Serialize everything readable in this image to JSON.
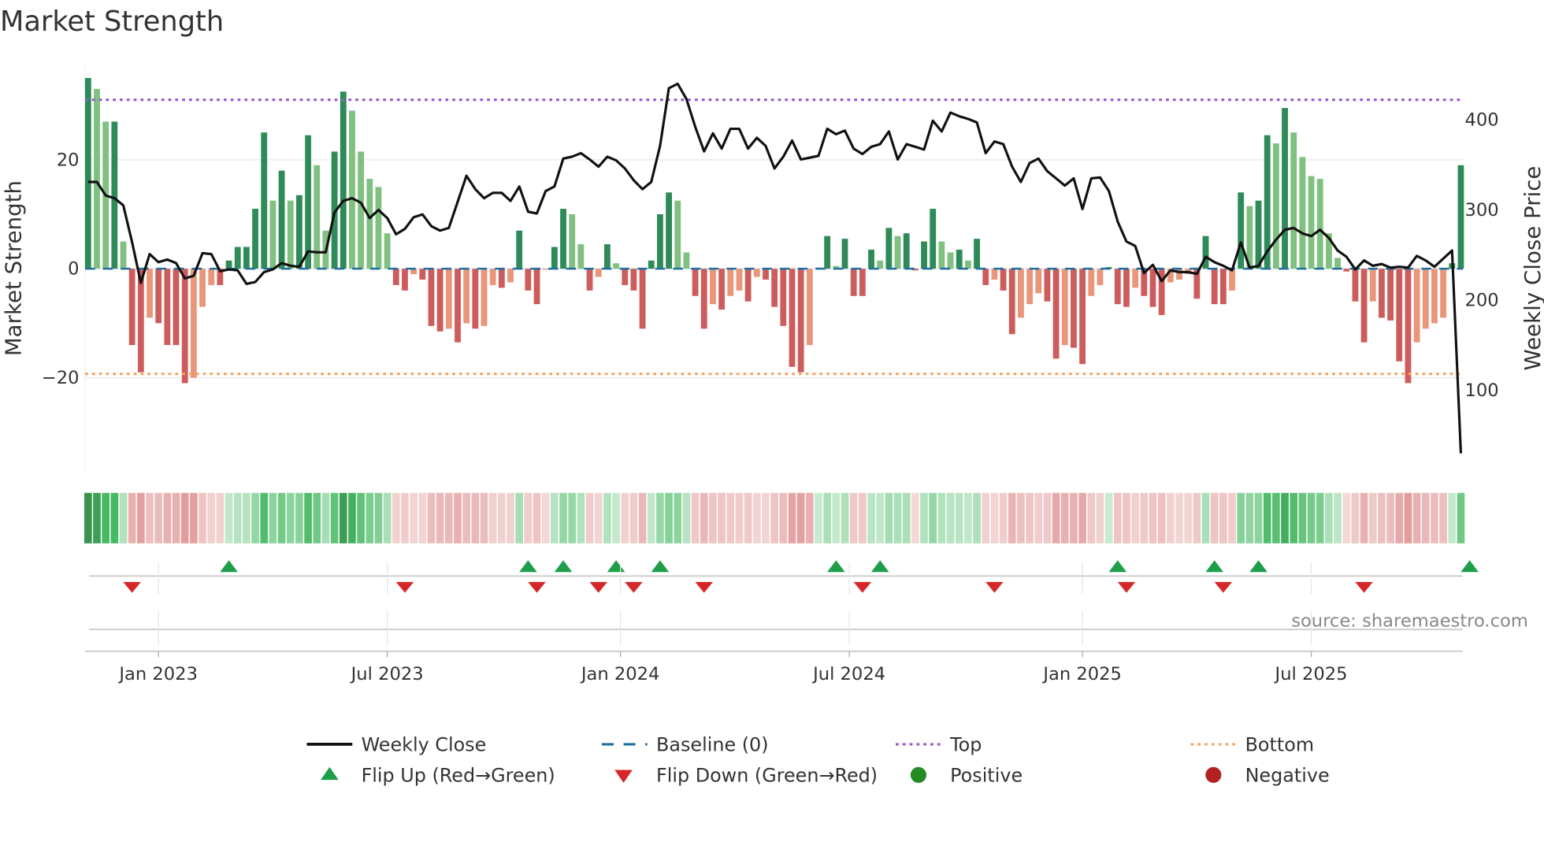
{
  "chart_data": {
    "type": "bar",
    "title": "Market Strength",
    "ylabel": "Market Strength",
    "y2label": "Weekly Close Price",
    "ylim": [
      -37.5,
      37.5
    ],
    "y2lim": [
      8,
      461.5
    ],
    "yticks": [
      -20,
      0,
      20
    ],
    "yticks_labels": [
      "−20",
      "0",
      "20"
    ],
    "y2ticks": [
      100,
      200,
      300,
      400
    ],
    "y2ticks_labels": [
      "100",
      "200",
      "300",
      "400"
    ],
    "xticks": [
      {
        "label": "Jan 2023",
        "index": 8
      },
      {
        "label": "Jul 2023",
        "index": 34
      },
      {
        "label": "Jan 2024",
        "index": 60.5
      },
      {
        "label": "Jul 2024",
        "index": 86.5
      },
      {
        "label": "Jan 2025",
        "index": 113
      },
      {
        "label": "Jul 2025",
        "index": 139
      }
    ],
    "top_level": 31,
    "bottom_level": -19.3,
    "baseline": 0,
    "grid": true,
    "strength": [
      35,
      33,
      27,
      27,
      5,
      -14,
      -19,
      -9,
      -10,
      -14,
      -14,
      -21,
      -20,
      -7,
      -3,
      -3,
      1.5,
      4,
      4,
      11,
      25,
      12.5,
      18,
      12.5,
      13.5,
      24.5,
      19,
      7,
      21.5,
      32.5,
      29,
      21.5,
      16.5,
      15,
      6.5,
      -3,
      -4,
      -1,
      -2,
      -10.5,
      -11.5,
      -11,
      -13.5,
      -10,
      -11,
      -10.5,
      -3,
      -3.5,
      -2.5,
      7,
      -4,
      -6.5,
      -0.2,
      4,
      11,
      10,
      4.5,
      -4,
      -1.5,
      4.5,
      1,
      -3,
      -4,
      -11,
      1.5,
      10,
      14,
      12.5,
      3,
      -5,
      -11,
      -6.5,
      -7.5,
      -5,
      -4,
      -6,
      -1.5,
      -2,
      -7,
      -10.5,
      -18,
      -19,
      -14,
      0.2,
      6,
      0.5,
      5.5,
      -5,
      -5,
      3.5,
      1.5,
      7.5,
      6,
      6.5,
      -0.3,
      5,
      11,
      5,
      3,
      3.5,
      1.5,
      5.5,
      -3,
      -2,
      -4,
      -12,
      -9,
      -6.5,
      -4.5,
      -6,
      -16.5,
      -14,
      -14.5,
      -17.5,
      -5,
      -3,
      0.3,
      -6.5,
      -7,
      -3.5,
      -5,
      -7,
      -8.5,
      -2.5,
      -2,
      -1,
      -5.5,
      6,
      -6.5,
      -6.5,
      -4,
      14,
      11.5,
      12.5,
      24.5,
      23,
      29.5,
      25,
      20.5,
      17,
      16.5,
      6.5,
      2,
      -0.5,
      -6,
      -13.5,
      -6,
      -9,
      -9.5,
      -17,
      -21,
      -13.5,
      -11,
      -10,
      -9,
      1,
      19
    ],
    "weekly_close": [
      331,
      331,
      316,
      313,
      305,
      264,
      219,
      251,
      242,
      245,
      241,
      224,
      227,
      252,
      251,
      232,
      234,
      233,
      218,
      220,
      231,
      234,
      241,
      238,
      237,
      254,
      253,
      253,
      297,
      310,
      313,
      308,
      291,
      300,
      291,
      273,
      279,
      292,
      295,
      282,
      277,
      280,
      309,
      338,
      323,
      313,
      319,
      319,
      310,
      326,
      298,
      296,
      321,
      326,
      357,
      359,
      363,
      356,
      348,
      359,
      355,
      346,
      333,
      323,
      331,
      371,
      435,
      440,
      423,
      392,
      365,
      385,
      368,
      390,
      390,
      368,
      380,
      371,
      346,
      359,
      377,
      356,
      358,
      360,
      390,
      384,
      388,
      368,
      362,
      370,
      373,
      387,
      356,
      373,
      370,
      367,
      399,
      387,
      408,
      404,
      401,
      397,
      363,
      376,
      373,
      348,
      331,
      352,
      357,
      343,
      335,
      327,
      335,
      301,
      335,
      336,
      321,
      287,
      265,
      260,
      230,
      239,
      221,
      233,
      231,
      231,
      229,
      248,
      242,
      238,
      233,
      264,
      236,
      238,
      254,
      267,
      278,
      280,
      274,
      271,
      278,
      269,
      255,
      248,
      234,
      244,
      238,
      240,
      236,
      237,
      236,
      249,
      244,
      237,
      246,
      255,
      30
    ],
    "flip_up_indices": [
      16,
      50,
      54,
      60,
      65,
      85,
      90,
      117,
      128,
      133,
      157
    ],
    "flip_down_indices": [
      5,
      36,
      51,
      58,
      62,
      70,
      88,
      103,
      118,
      129,
      145
    ],
    "colors": {
      "positive_strong": "#2e8b57",
      "positive_weak": "#80c080",
      "negative_strong": "#cd5c5c",
      "negative_weak": "#e9967a",
      "top": "#9b59d0",
      "bottom": "#f4a460",
      "baseline": "#1f6f9f",
      "close": "#111111",
      "flip_up": "#1e9e4a",
      "flip_down": "#d62728",
      "positive_dot": "#228b22",
      "negative_dot": "#b22222"
    },
    "legend": {
      "placement": "bottom",
      "items": [
        {
          "label": "Weekly Close",
          "kind": "line"
        },
        {
          "label": "Baseline (0)",
          "kind": "dash"
        },
        {
          "label": "Top",
          "kind": "dot-purple"
        },
        {
          "label": "Bottom",
          "kind": "dot-orange"
        },
        {
          "label": "Flip Up (Red→Green)",
          "kind": "tri-up"
        },
        {
          "label": "Flip Down (Green→Red)",
          "kind": "tri-down"
        },
        {
          "label": "Positive",
          "kind": "circle-green"
        },
        {
          "label": "Negative",
          "kind": "circle-red"
        }
      ]
    },
    "source": "source: sharemaestro.com"
  }
}
